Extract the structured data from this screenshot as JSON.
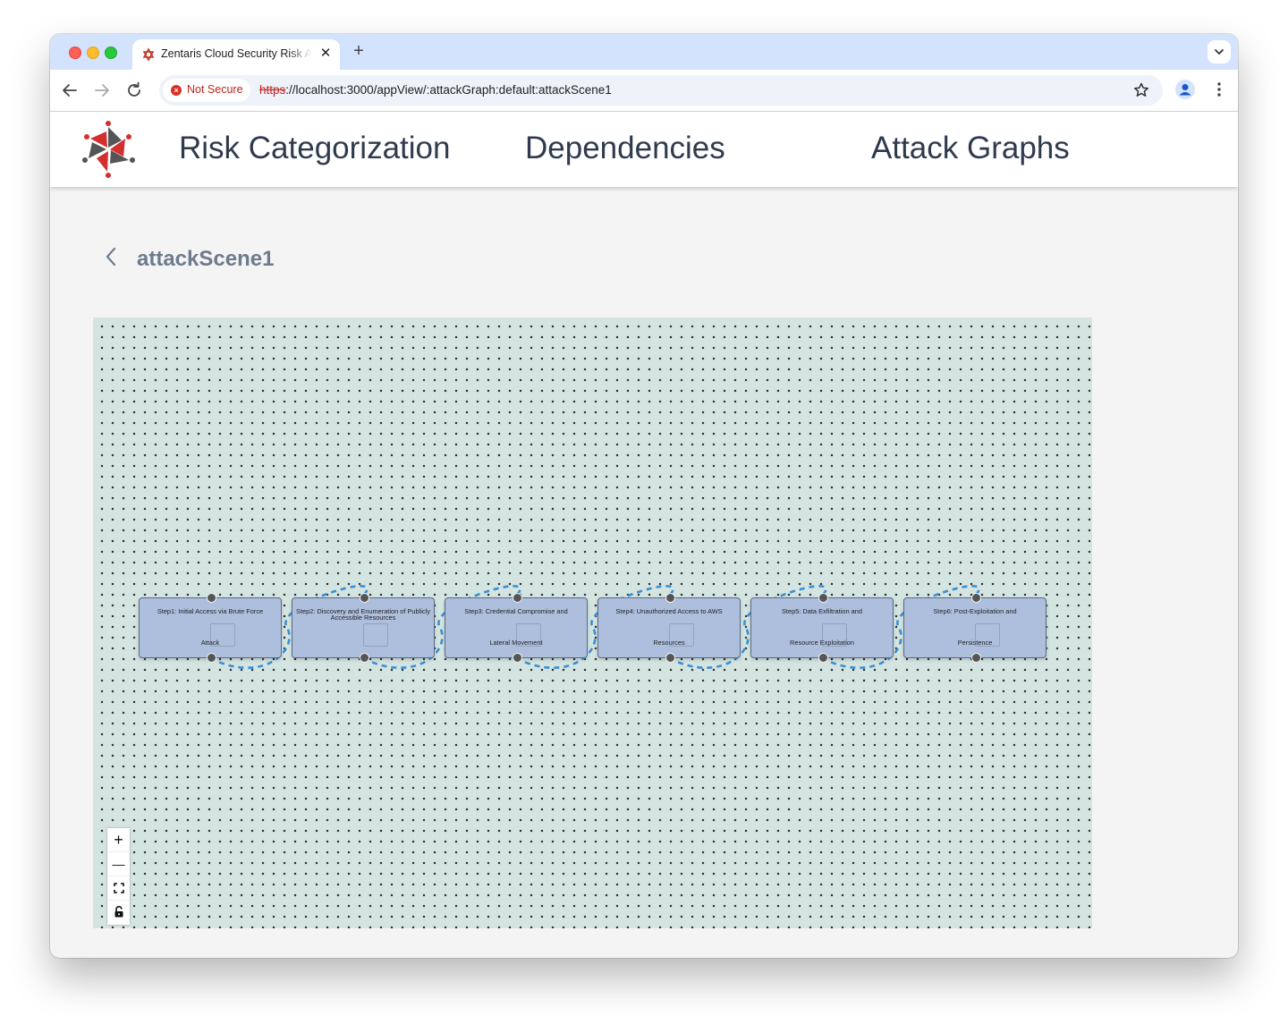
{
  "browser": {
    "tab_title": "Zentaris Cloud Security Risk Assessment",
    "new_tab_label": "+",
    "tab_close_label": "✕",
    "security_chip": "Not Secure",
    "url_scheme": "https",
    "url_rest": "://localhost:3000/appView/:attackGraph:default:attackScene1"
  },
  "app": {
    "nav": [
      "Risk Categorization",
      "Dependencies",
      "Attack Graphs"
    ]
  },
  "page": {
    "back_icon": "chevron-left-icon",
    "title": "attackScene1"
  },
  "graph": {
    "edge_color": "#3a8fd6",
    "node_color": "#aebfde",
    "nodes": [
      {
        "line1": "Step1: Initial Access via Brute Force",
        "line2": "Attack"
      },
      {
        "line1": "Step2: Discovery and Enumeration of Publicly Accessible Resources",
        "line2": ""
      },
      {
        "line1": "Step3: Credential Compromise and",
        "line2": "Lateral Movement"
      },
      {
        "line1": "Step4: Unauthorized Access to AWS",
        "line2": "Resources"
      },
      {
        "line1": "Step5: Data Exfiltration and",
        "line2": "Resource Exploitation"
      },
      {
        "line1": "Step6: Post-Exploitation and",
        "line2": "Persistence"
      }
    ]
  },
  "controls": {
    "zoom_in": "+",
    "zoom_out": "—",
    "fit_view_icon": "fit-view-icon",
    "lock_icon": "lock-icon"
  }
}
